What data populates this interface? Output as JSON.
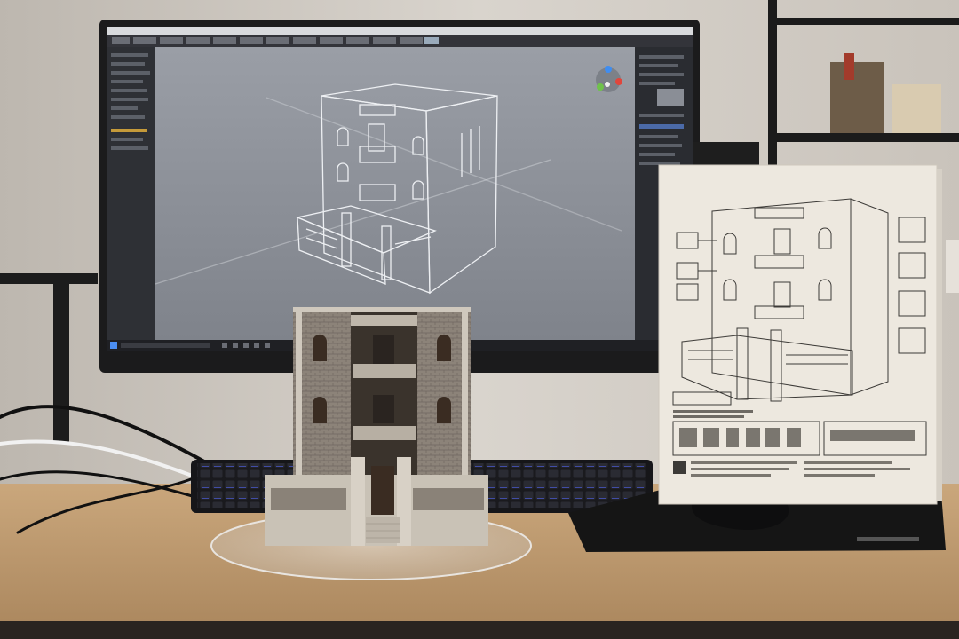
{
  "scene": {
    "description_colors": {
      "wall": "#d8d3cc",
      "desk": "#c8a77e",
      "monitor_bezel": "#1b1b1c",
      "viewport": "#8f939a",
      "wireframe": "#f4f6f8",
      "brick": "#8a8076",
      "box_paper": "#ece6dc",
      "mousepad": "#151515"
    }
  },
  "monitor": {
    "taskbar_clock": ""
  }
}
